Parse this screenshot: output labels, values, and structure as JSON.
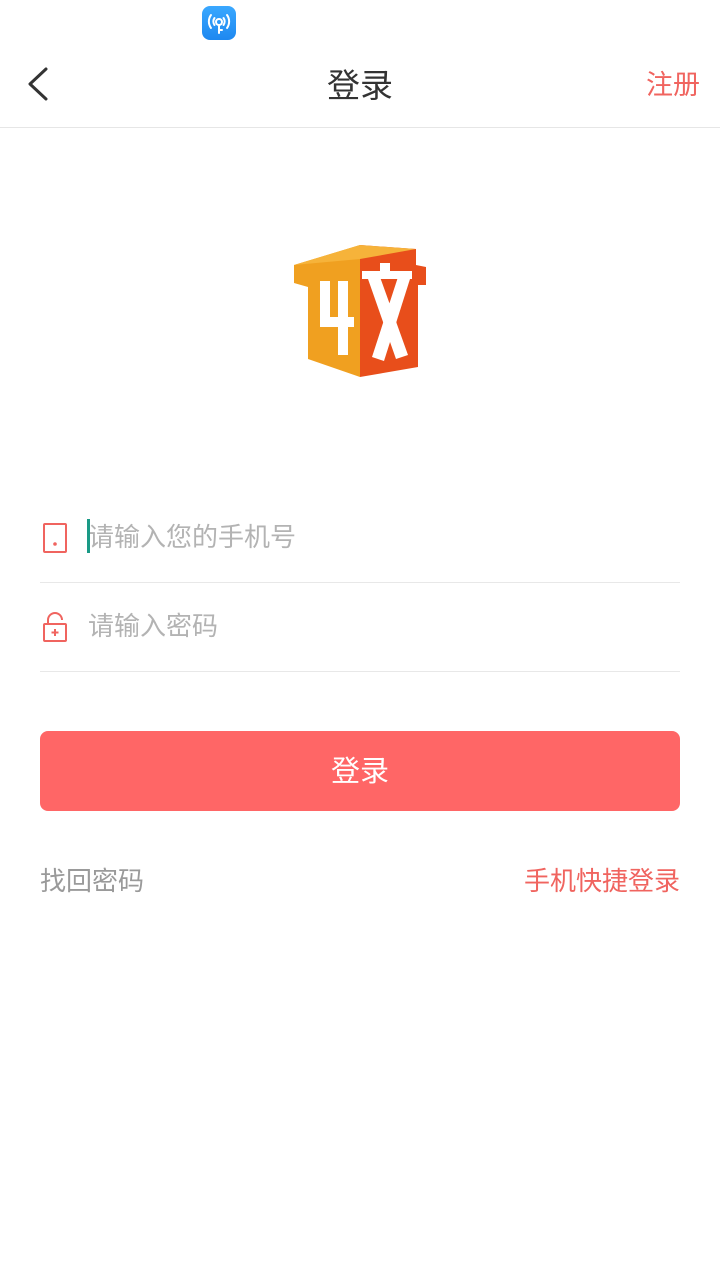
{
  "status_bar": {
    "app_icon": "wifi-key-icon"
  },
  "header": {
    "back_icon": "chevron-left-icon",
    "title": "登录",
    "register_label": "注册"
  },
  "logo": {
    "icon": "app-logo-house-icon"
  },
  "form": {
    "phone": {
      "icon": "phone-icon",
      "placeholder": "请输入您的手机号",
      "value": ""
    },
    "password": {
      "icon": "lock-icon",
      "placeholder": "请输入密码",
      "value": ""
    }
  },
  "actions": {
    "login_label": "登录",
    "recover_label": "找回密码",
    "quick_login_label": "手机快捷登录"
  },
  "colors": {
    "accent": "#ff6666",
    "link": "#f0645f",
    "caret": "#1a9a86"
  }
}
